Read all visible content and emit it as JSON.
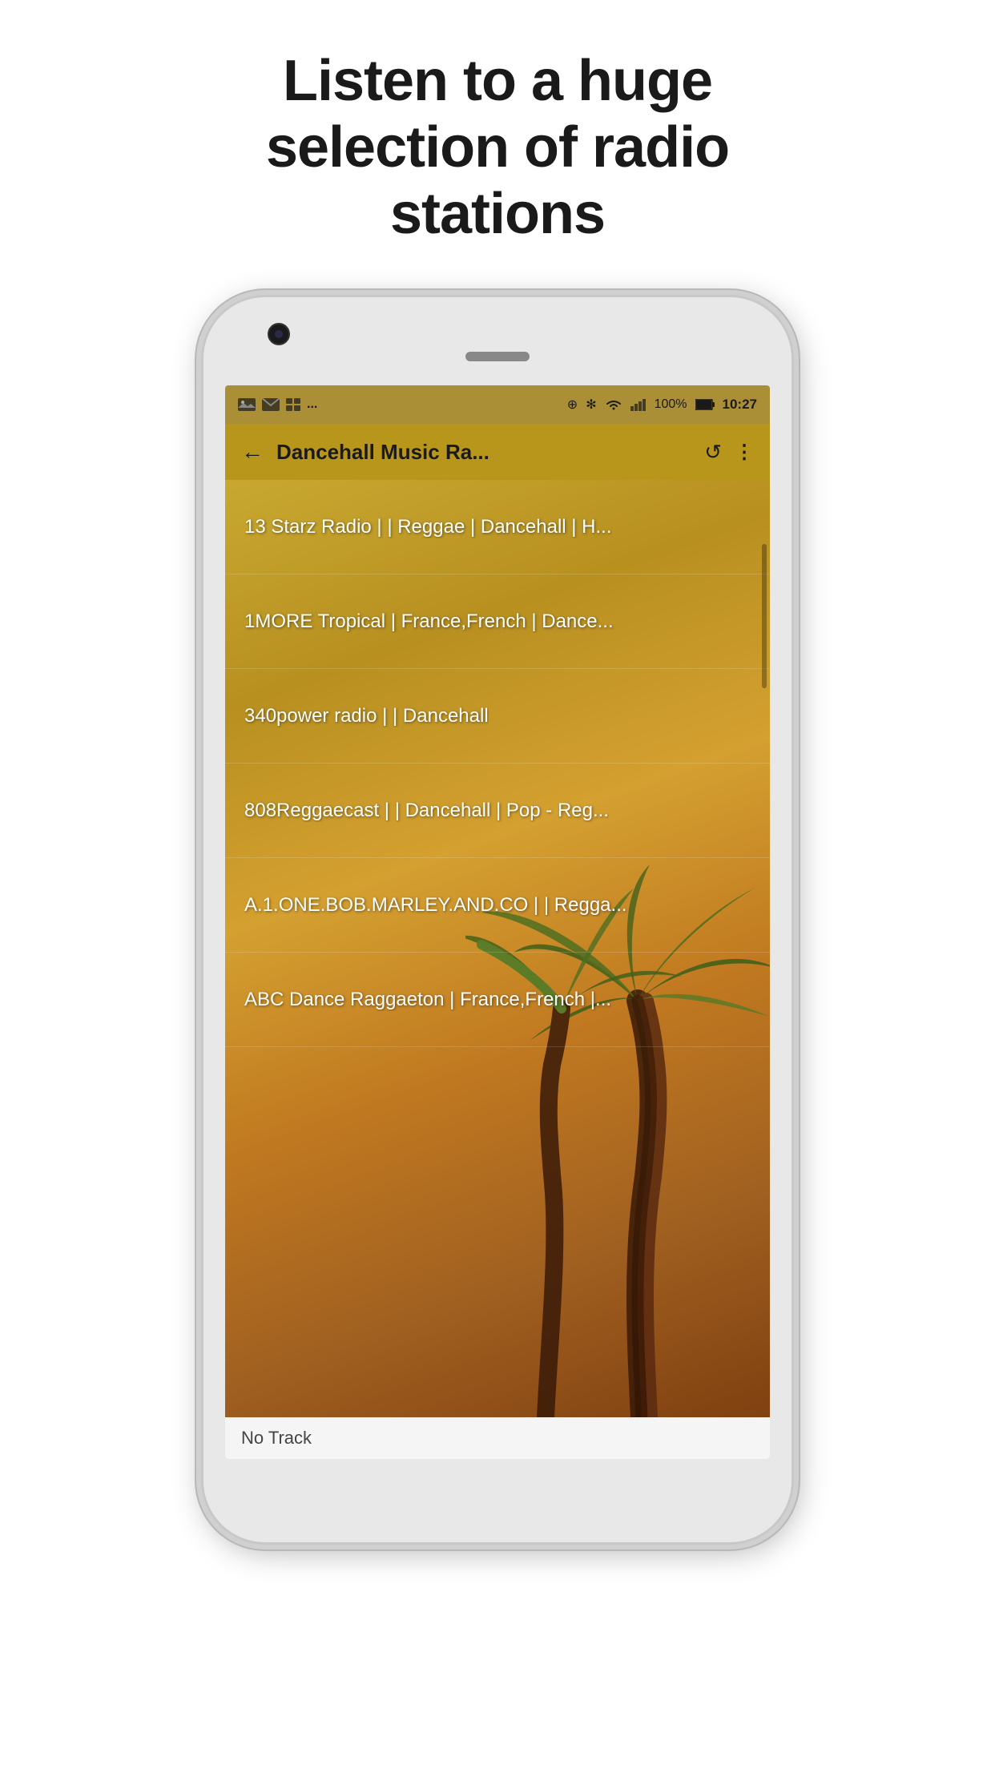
{
  "hero": {
    "title": "Listen to a huge selection of radio stations"
  },
  "status_bar": {
    "left_icons": [
      "image",
      "mail",
      "grid",
      "..."
    ],
    "right": {
      "sync": "⊕",
      "bluetooth": "✻",
      "wifi": "WiFi",
      "signal": "▐▌",
      "battery": "100%",
      "time": "10:27"
    }
  },
  "toolbar": {
    "back_icon": "←",
    "title": "Dancehall Music Ra...",
    "refresh_icon": "↺",
    "more_icon": "⋮"
  },
  "stations": [
    {
      "name": "13 Starz Radio | | Reggae | Dancehall | H..."
    },
    {
      "name": "1MORE Tropical | France,French | Dance..."
    },
    {
      "name": "340power radio | | Dancehall"
    },
    {
      "name": "808Reggaecast | | Dancehall | Pop - Reg..."
    },
    {
      "name": "A.1.ONE.BOB.MARLEY.AND.CO | | Regga..."
    },
    {
      "name": "ABC Dance Raggaeton | France,French |..."
    }
  ],
  "bottom_bar": {
    "no_track_label": "No Track"
  },
  "colors": {
    "toolbar_bg": "#b8961c",
    "screen_bg": "#c8a830",
    "text_white": "#ffffff",
    "text_dark": "#1a1a1a"
  }
}
